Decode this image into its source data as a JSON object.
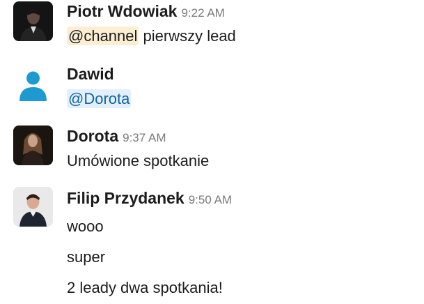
{
  "messages": [
    {
      "author": "Piotr Wdowiak",
      "time": "9:22 AM",
      "avatar": "photo-man-dark",
      "mention": "@channel",
      "text": " pierwszy lead"
    },
    {
      "author": "Dawid",
      "time": "",
      "avatar": "default-user-icon",
      "mention": "@Dorota"
    },
    {
      "author": "Dorota",
      "time": "9:37 AM",
      "avatar": "photo-woman-dark",
      "text": "Umówione spotkanie"
    },
    {
      "author": "Filip Przydanek",
      "time": "9:50 AM",
      "avatar": "photo-man-light",
      "lines": [
        "wooo",
        "super",
        "2 leady dwa spotkania!"
      ]
    }
  ],
  "colors": {
    "channel_mention_bg": "#fbefd3",
    "user_mention_bg": "#e3f0fb",
    "user_mention_text": "#1264a3",
    "default_avatar_bg": "#1d9bd1",
    "timestamp": "#7a7a7a"
  }
}
